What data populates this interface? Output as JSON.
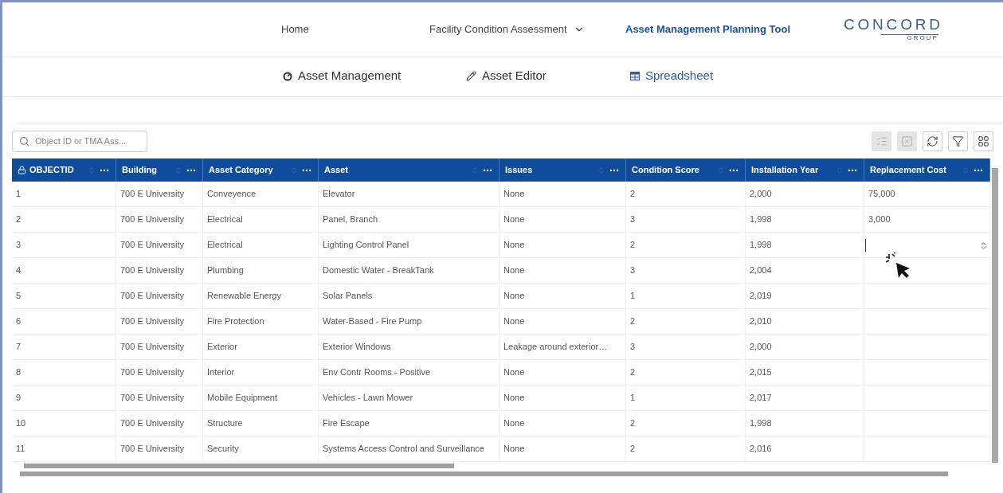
{
  "nav": {
    "items": [
      {
        "label": "Home",
        "selected": false,
        "kind": "link"
      },
      {
        "label": "Facility Condition Assessment",
        "selected": false,
        "kind": "dropdown"
      },
      {
        "label": "Asset Management Planning Tool",
        "selected": true,
        "kind": "link"
      }
    ],
    "logo": {
      "name": "CONCORD",
      "subtitle": "GROUP"
    }
  },
  "subnav": [
    {
      "label": "Asset Management",
      "selected": false,
      "kind": "gauge"
    },
    {
      "label": "Asset Editor",
      "selected": false,
      "kind": "pencil"
    },
    {
      "label": "Spreadsheet",
      "selected": true,
      "kind": "sheet"
    }
  ],
  "search": {
    "placeholder": "Object ID or TMA Ass..."
  },
  "toolbar": [
    {
      "kind": "list",
      "disabled": true
    },
    {
      "kind": "clear",
      "disabled": true
    },
    {
      "kind": "refresh",
      "disabled": false
    },
    {
      "kind": "filter",
      "disabled": false
    },
    {
      "kind": "grid",
      "disabled": false
    }
  ],
  "table": {
    "columns": [
      "OBJECTID",
      "Building",
      "Asset Category",
      "Asset",
      "Issues",
      "Condition Score",
      "Installation Year",
      "Replacement Cost"
    ],
    "rows": [
      {
        "cells": [
          "1",
          "700 E University",
          "Conveyence",
          "Elevator",
          "None",
          "2",
          "2,000",
          "75,000"
        ],
        "editing": false
      },
      {
        "cells": [
          "2",
          "700 E University",
          "Electrical",
          "Panel, Branch",
          "None",
          "3",
          "1,998",
          "3,000"
        ],
        "editing": false
      },
      {
        "cells": [
          "3",
          "700 E University",
          "Electrical",
          "Lighting Control Panel",
          "None",
          "2",
          "1,998",
          ""
        ],
        "editing": true
      },
      {
        "cells": [
          "4",
          "700 E University",
          "Plumbing",
          "Domestic Water - BreakTank",
          "None",
          "3",
          "2,004",
          ""
        ],
        "editing": false
      },
      {
        "cells": [
          "5",
          "700 E University",
          "Renewable Energy",
          "Solar Panels",
          "None",
          "1",
          "2,019",
          ""
        ],
        "editing": false
      },
      {
        "cells": [
          "6",
          "700 E University",
          "Fire Protection",
          "Water-Based - Fire Pump",
          "None",
          "2",
          "2,010",
          ""
        ],
        "editing": false
      },
      {
        "cells": [
          "7",
          "700 E University",
          "Exterior",
          "Exterior Windows",
          "Leakage around exterior…",
          "3",
          "2,000",
          ""
        ],
        "editing": false
      },
      {
        "cells": [
          "8",
          "700 E University",
          "Interior",
          "Env Contr Rooms - Positive",
          "None",
          "2",
          "2,015",
          ""
        ],
        "editing": false
      },
      {
        "cells": [
          "9",
          "700 E University",
          "Mobile Equipment",
          "Vehicles - Lawn Mower",
          "None",
          "1",
          "2,017",
          ""
        ],
        "editing": false
      },
      {
        "cells": [
          "10",
          "700 E University",
          "Structure",
          "Fire Escape",
          "None",
          "2",
          "1,998",
          ""
        ],
        "editing": false
      },
      {
        "cells": [
          "11",
          "700 E University",
          "Security",
          "Systems Access Control and Surveillance",
          "None",
          "2",
          "2,016",
          ""
        ],
        "editing": false
      }
    ]
  }
}
